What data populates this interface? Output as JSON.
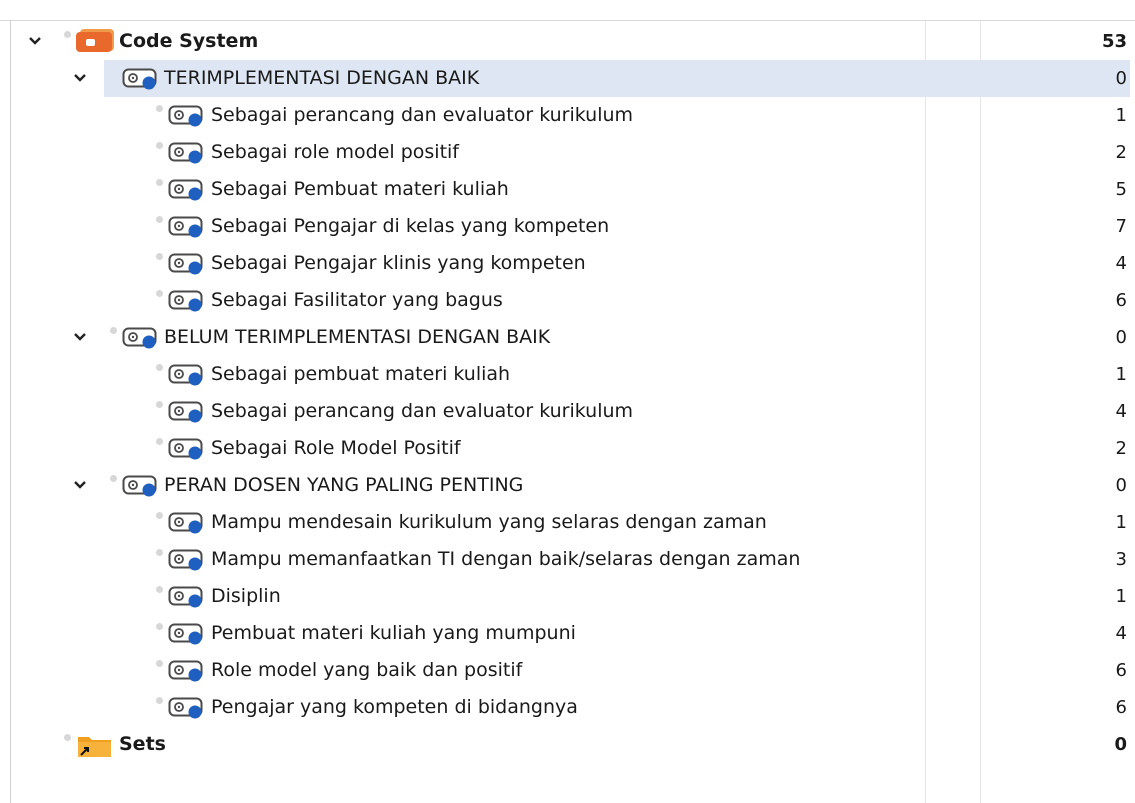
{
  "root": {
    "label": "Code System",
    "count": "53",
    "icon": "code-system-icon"
  },
  "groups": [
    {
      "label": "TERIMPLEMENTASI DENGAN BAIK",
      "count": "0",
      "selected": true,
      "children": [
        {
          "label": "Sebagai perancang dan evaluator kurikulum",
          "count": "1"
        },
        {
          "label": "Sebagai role model positif",
          "count": "2"
        },
        {
          "label": "Sebagai Pembuat materi kuliah",
          "count": "5"
        },
        {
          "label": "Sebagai Pengajar di kelas yang kompeten",
          "count": "7"
        },
        {
          "label": "Sebagai Pengajar klinis yang kompeten",
          "count": "4"
        },
        {
          "label": "Sebagai Fasilitator yang bagus",
          "count": "6"
        }
      ]
    },
    {
      "label": "BELUM TERIMPLEMENTASI DENGAN BAIK",
      "count": "0",
      "selected": false,
      "children": [
        {
          "label": "Sebagai pembuat materi kuliah",
          "count": "1"
        },
        {
          "label": "Sebagai perancang dan evaluator kurikulum",
          "count": "4"
        },
        {
          "label": "Sebagai Role Model Positif",
          "count": "2"
        }
      ]
    },
    {
      "label": "PERAN DOSEN YANG PALING PENTING",
      "count": "0",
      "selected": false,
      "children": [
        {
          "label": "Mampu mendesain kurikulum yang selaras dengan zaman",
          "count": "1"
        },
        {
          "label": "Mampu memanfaatkan TI dengan baik/selaras dengan zaman",
          "count": "3"
        },
        {
          "label": "Disiplin",
          "count": "1"
        },
        {
          "label": "Pembuat materi kuliah yang mumpuni",
          "count": "4"
        },
        {
          "label": "Role model yang baik dan positif",
          "count": "6"
        },
        {
          "label": "Pengajar yang kompeten di bidangnya",
          "count": "6"
        }
      ]
    }
  ],
  "sets": {
    "label": "Sets",
    "count": "0",
    "icon": "sets-folder-icon"
  },
  "colors": {
    "selection": "#dde6f2",
    "code_dot": "#1f5fbf",
    "root_icon": "#e9682b",
    "folder": "#f0a020"
  }
}
